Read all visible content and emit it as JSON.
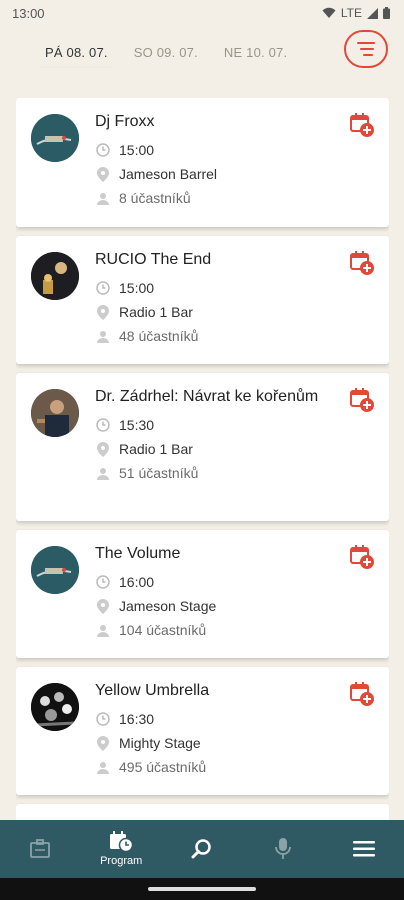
{
  "status_bar": {
    "time": "13:00",
    "network": "LTE"
  },
  "day_tabs": [
    {
      "label": "PÁ 08. 07.",
      "active": true
    },
    {
      "label": "SO 09. 07.",
      "active": false
    },
    {
      "label": "NE 10. 07.",
      "active": false
    }
  ],
  "events": [
    {
      "title": "Dj Froxx",
      "time": "15:00",
      "venue": "Jameson Barrel",
      "attendees": "8 účastníků",
      "avatar_color": "#2b5c66"
    },
    {
      "title": "RUCIO The End",
      "time": "15:00",
      "venue": "Radio 1 Bar",
      "attendees": "48 účastníků",
      "avatar_color": "#1d1d22"
    },
    {
      "title": "Dr. Zádrhel: Návrat ke kořenům",
      "time": "15:30",
      "venue": "Radio 1 Bar",
      "attendees": "51 účastníků",
      "avatar_color": "#3a2a22"
    },
    {
      "title": "The Volume",
      "time": "16:00",
      "venue": "Jameson Stage",
      "attendees": "104 účastníků",
      "avatar_color": "#2b5c66"
    },
    {
      "title": "Yellow Umbrella",
      "time": "16:30",
      "venue": "Mighty Stage",
      "attendees": "495 účastníků",
      "avatar_color": "#2a2a2a"
    }
  ],
  "bottom_nav": {
    "items": [
      {
        "name": "tickets",
        "label": ""
      },
      {
        "name": "program",
        "label": "Program",
        "active": true
      },
      {
        "name": "search",
        "label": ""
      },
      {
        "name": "artists",
        "label": ""
      },
      {
        "name": "menu",
        "label": ""
      }
    ]
  },
  "colors": {
    "accent": "#e0483a",
    "nav_bg": "#2f5a64",
    "page_bg": "#f3efe6"
  }
}
